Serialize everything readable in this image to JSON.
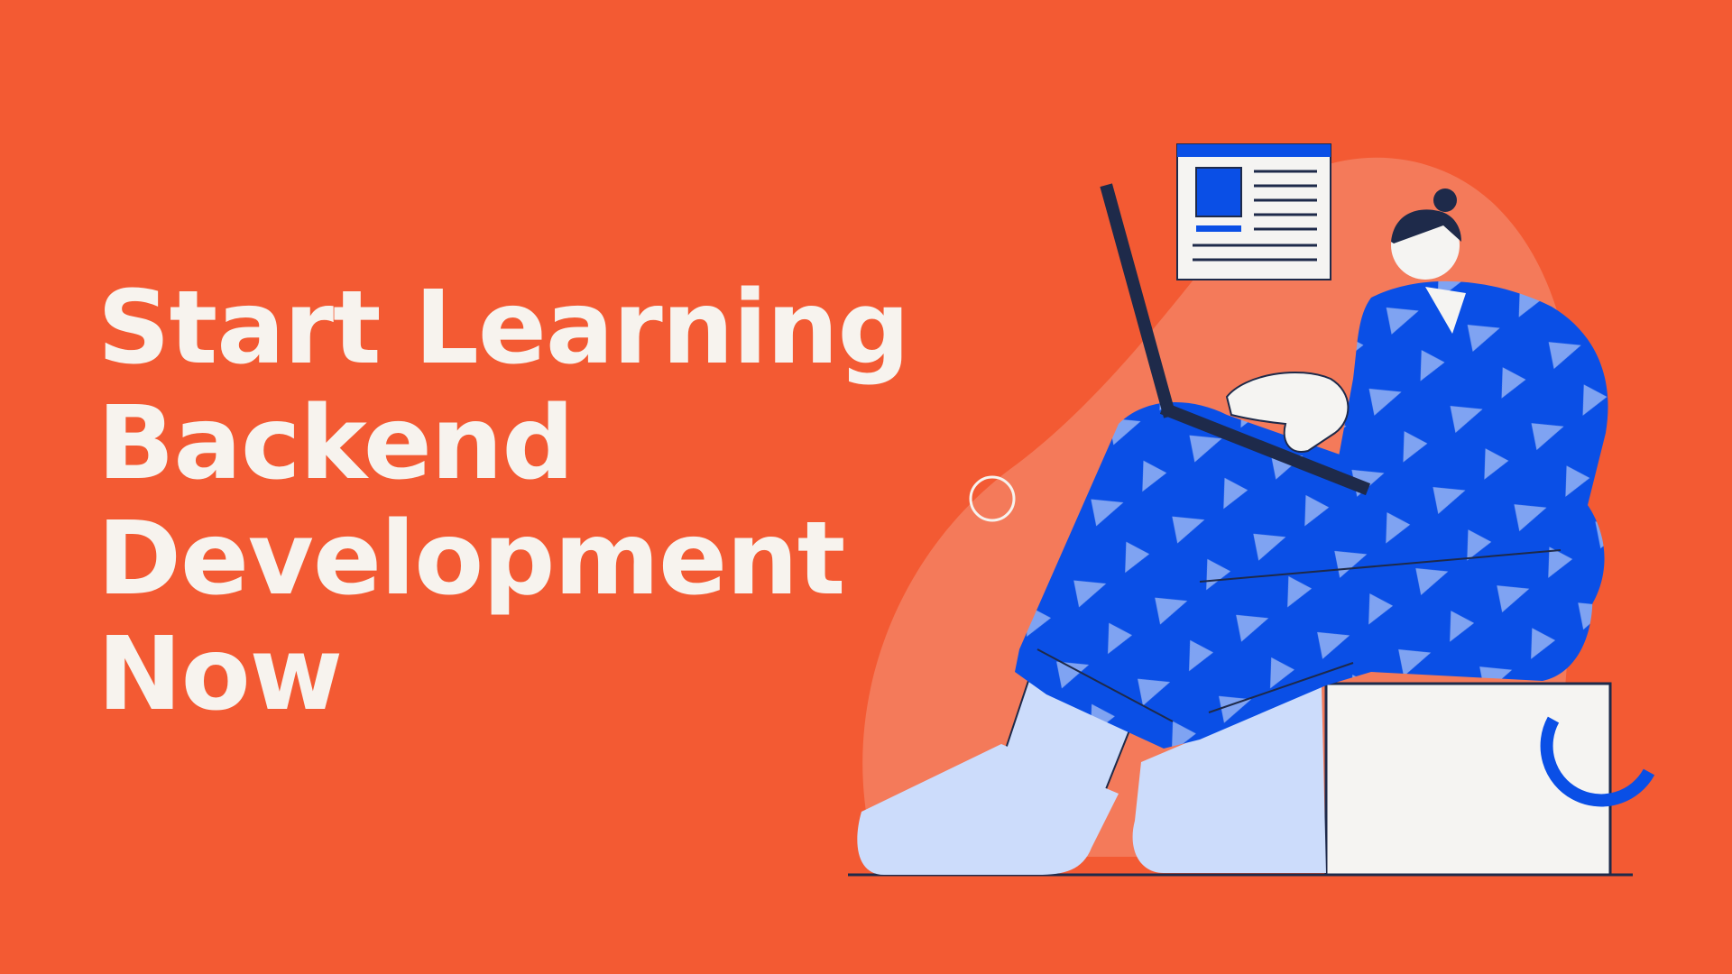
{
  "headline": {
    "lines": [
      "Start Learning",
      "Backend",
      "Development",
      "Now"
    ]
  },
  "colors": {
    "background": "#F35A33",
    "backdrop_blob": "#F47A5A",
    "text": "#F7F3EE",
    "suit_blue": "#0A4FE6",
    "pattern_light_blue": "#7FA3F2",
    "sock_light_blue": "#CCDCFB",
    "navy": "#1E2A4A",
    "off_white": "#F5F4F2"
  },
  "icons": [
    "browser-window-icon",
    "ring-icon",
    "arc-icon"
  ]
}
